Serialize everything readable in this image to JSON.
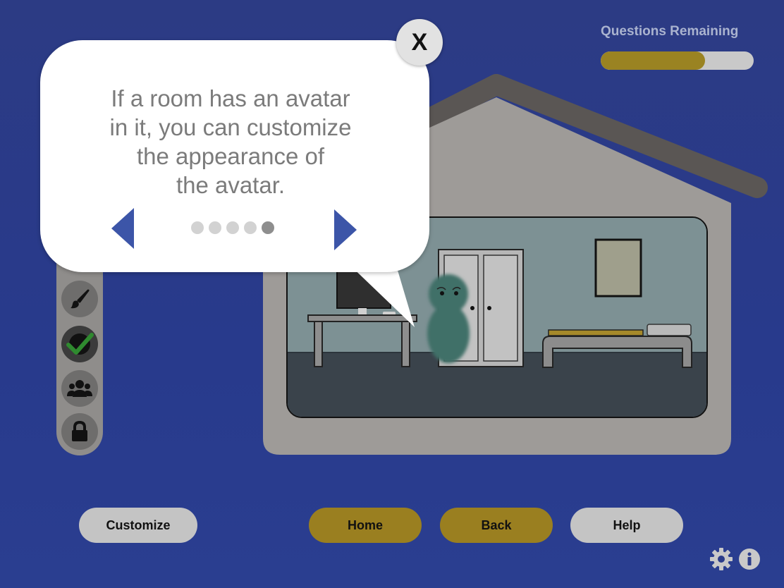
{
  "progress": {
    "label": "Questions Remaining",
    "fraction": 0.68
  },
  "tutorial": {
    "close_label": "X",
    "lines": [
      "If a room has an avatar",
      "in it, you can customize",
      "the appearance of",
      "the avatar."
    ],
    "prev_icon": "left-triangle-arrow",
    "next_icon": "right-triangle-arrow",
    "page_count": 5,
    "current_page": 5
  },
  "sidebar": {
    "items": [
      {
        "name": "paintbrush-icon"
      },
      {
        "name": "checkmark-icon"
      },
      {
        "name": "group-icon"
      },
      {
        "name": "lock-icon"
      }
    ]
  },
  "buttons": {
    "customize": "Customize",
    "home": "Home",
    "back": "Back",
    "help": "Help"
  },
  "colors": {
    "background": "#2b3c8a",
    "gold": "#9a7f20",
    "button_gray": "#c4c4c4",
    "arrow_blue": "#3c55a8",
    "avatar": "#3f6f68"
  }
}
